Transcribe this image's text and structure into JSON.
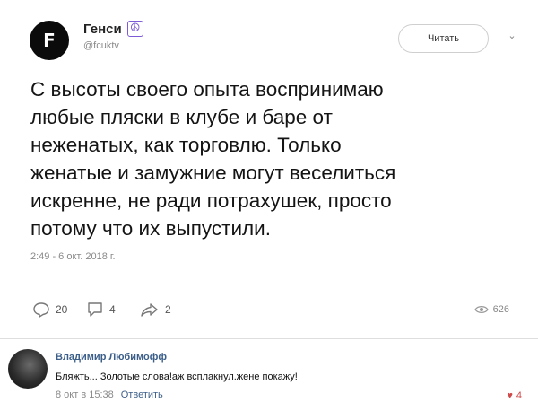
{
  "tweet": {
    "avatar_letter": "F",
    "author_name": "Генси",
    "author_badge_icon": "peace-icon",
    "handle": "@fcuktv",
    "follow_label": "Читать",
    "menu_icon": "chevron-down-icon",
    "text": "С высоты своего опыта воспринимаю\nлюбые пляски в клубе и баре от\nнеженатых, как торговлю. Только\nженатые и замужние могут веселиться\nискренне, не ради потрахушек, просто\nпотому что их выпустили.",
    "timestamp": "2:49 - 6 окт. 2018 г.",
    "replies_count": "20",
    "retweets_count": "4",
    "likes_count": "2",
    "views_count": "626"
  },
  "comment": {
    "author": "Владимир Любимофф",
    "text": "Бляжть... Золотые слова!аж всплакнул.жене покажу!",
    "date": "8 окт в 15:38",
    "reply_label": "Ответить",
    "likes": "4"
  }
}
